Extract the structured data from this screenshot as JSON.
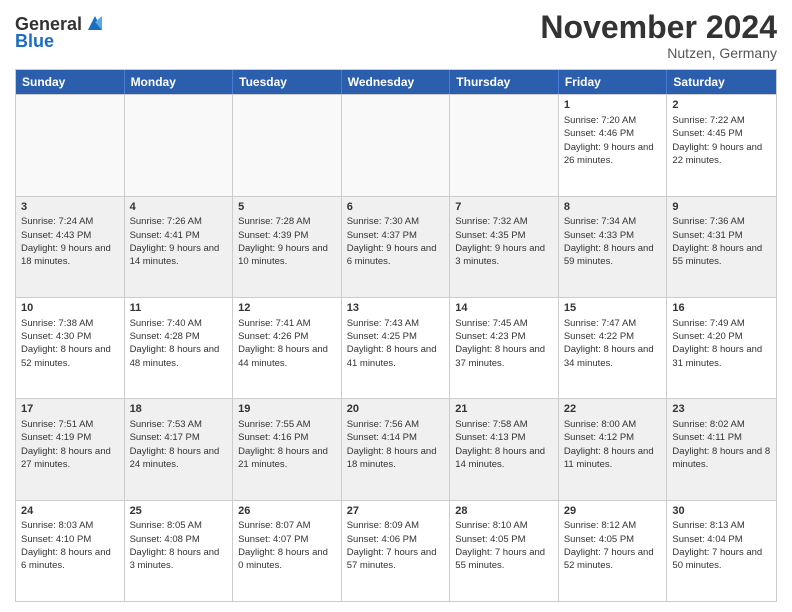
{
  "logo": {
    "line1": "General",
    "line2": "Blue"
  },
  "header": {
    "month": "November 2024",
    "location": "Nutzen, Germany"
  },
  "days": [
    "Sunday",
    "Monday",
    "Tuesday",
    "Wednesday",
    "Thursday",
    "Friday",
    "Saturday"
  ],
  "rows": [
    [
      {
        "day": "",
        "text": ""
      },
      {
        "day": "",
        "text": ""
      },
      {
        "day": "",
        "text": ""
      },
      {
        "day": "",
        "text": ""
      },
      {
        "day": "",
        "text": ""
      },
      {
        "day": "1",
        "text": "Sunrise: 7:20 AM\nSunset: 4:46 PM\nDaylight: 9 hours and 26 minutes."
      },
      {
        "day": "2",
        "text": "Sunrise: 7:22 AM\nSunset: 4:45 PM\nDaylight: 9 hours and 22 minutes."
      }
    ],
    [
      {
        "day": "3",
        "text": "Sunrise: 7:24 AM\nSunset: 4:43 PM\nDaylight: 9 hours and 18 minutes."
      },
      {
        "day": "4",
        "text": "Sunrise: 7:26 AM\nSunset: 4:41 PM\nDaylight: 9 hours and 14 minutes."
      },
      {
        "day": "5",
        "text": "Sunrise: 7:28 AM\nSunset: 4:39 PM\nDaylight: 9 hours and 10 minutes."
      },
      {
        "day": "6",
        "text": "Sunrise: 7:30 AM\nSunset: 4:37 PM\nDaylight: 9 hours and 6 minutes."
      },
      {
        "day": "7",
        "text": "Sunrise: 7:32 AM\nSunset: 4:35 PM\nDaylight: 9 hours and 3 minutes."
      },
      {
        "day": "8",
        "text": "Sunrise: 7:34 AM\nSunset: 4:33 PM\nDaylight: 8 hours and 59 minutes."
      },
      {
        "day": "9",
        "text": "Sunrise: 7:36 AM\nSunset: 4:31 PM\nDaylight: 8 hours and 55 minutes."
      }
    ],
    [
      {
        "day": "10",
        "text": "Sunrise: 7:38 AM\nSunset: 4:30 PM\nDaylight: 8 hours and 52 minutes."
      },
      {
        "day": "11",
        "text": "Sunrise: 7:40 AM\nSunset: 4:28 PM\nDaylight: 8 hours and 48 minutes."
      },
      {
        "day": "12",
        "text": "Sunrise: 7:41 AM\nSunset: 4:26 PM\nDaylight: 8 hours and 44 minutes."
      },
      {
        "day": "13",
        "text": "Sunrise: 7:43 AM\nSunset: 4:25 PM\nDaylight: 8 hours and 41 minutes."
      },
      {
        "day": "14",
        "text": "Sunrise: 7:45 AM\nSunset: 4:23 PM\nDaylight: 8 hours and 37 minutes."
      },
      {
        "day": "15",
        "text": "Sunrise: 7:47 AM\nSunset: 4:22 PM\nDaylight: 8 hours and 34 minutes."
      },
      {
        "day": "16",
        "text": "Sunrise: 7:49 AM\nSunset: 4:20 PM\nDaylight: 8 hours and 31 minutes."
      }
    ],
    [
      {
        "day": "17",
        "text": "Sunrise: 7:51 AM\nSunset: 4:19 PM\nDaylight: 8 hours and 27 minutes."
      },
      {
        "day": "18",
        "text": "Sunrise: 7:53 AM\nSunset: 4:17 PM\nDaylight: 8 hours and 24 minutes."
      },
      {
        "day": "19",
        "text": "Sunrise: 7:55 AM\nSunset: 4:16 PM\nDaylight: 8 hours and 21 minutes."
      },
      {
        "day": "20",
        "text": "Sunrise: 7:56 AM\nSunset: 4:14 PM\nDaylight: 8 hours and 18 minutes."
      },
      {
        "day": "21",
        "text": "Sunrise: 7:58 AM\nSunset: 4:13 PM\nDaylight: 8 hours and 14 minutes."
      },
      {
        "day": "22",
        "text": "Sunrise: 8:00 AM\nSunset: 4:12 PM\nDaylight: 8 hours and 11 minutes."
      },
      {
        "day": "23",
        "text": "Sunrise: 8:02 AM\nSunset: 4:11 PM\nDaylight: 8 hours and 8 minutes."
      }
    ],
    [
      {
        "day": "24",
        "text": "Sunrise: 8:03 AM\nSunset: 4:10 PM\nDaylight: 8 hours and 6 minutes."
      },
      {
        "day": "25",
        "text": "Sunrise: 8:05 AM\nSunset: 4:08 PM\nDaylight: 8 hours and 3 minutes."
      },
      {
        "day": "26",
        "text": "Sunrise: 8:07 AM\nSunset: 4:07 PM\nDaylight: 8 hours and 0 minutes."
      },
      {
        "day": "27",
        "text": "Sunrise: 8:09 AM\nSunset: 4:06 PM\nDaylight: 7 hours and 57 minutes."
      },
      {
        "day": "28",
        "text": "Sunrise: 8:10 AM\nSunset: 4:05 PM\nDaylight: 7 hours and 55 minutes."
      },
      {
        "day": "29",
        "text": "Sunrise: 8:12 AM\nSunset: 4:05 PM\nDaylight: 7 hours and 52 minutes."
      },
      {
        "day": "30",
        "text": "Sunrise: 8:13 AM\nSunset: 4:04 PM\nDaylight: 7 hours and 50 minutes."
      }
    ]
  ]
}
